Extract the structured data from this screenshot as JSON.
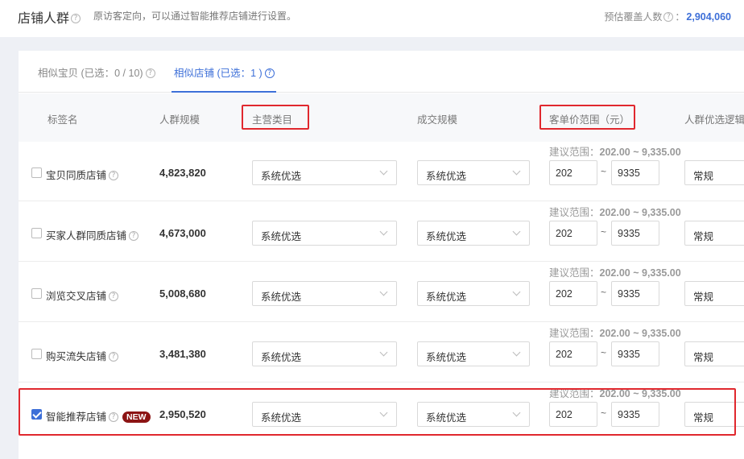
{
  "header": {
    "title": "店铺人群",
    "description": "原访客定向，可以通过智能推荐店铺进行设置。",
    "estimate_label": "预估覆盖人数",
    "estimate_suffix": "：",
    "estimate_value": "2,904,060"
  },
  "tabs": [
    {
      "label": "相似宝贝 (已选：0 / 10)",
      "active": false
    },
    {
      "label": "相似店铺 (已选：1 )",
      "active": true
    }
  ],
  "columns": {
    "tag_name": "标签名",
    "audience_size": "人群规模",
    "main_category": "主营类目",
    "deal_scale": "成交规模",
    "price_range": "客单价范围（元）",
    "logic": "人群优选逻辑"
  },
  "rows": [
    {
      "name": "宝贝同质店铺",
      "scale": "4,823,820",
      "category": "系统优选",
      "deal": "系统优选",
      "hint_label": "建议范围：",
      "hint_value": "202.00 ~ 9,335.00",
      "min": "202",
      "tilde": "~",
      "max": "9335",
      "logic": "常规",
      "checked": false,
      "badge": ""
    },
    {
      "name": "买家人群同质店铺",
      "scale": "4,673,000",
      "category": "系统优选",
      "deal": "系统优选",
      "hint_label": "建议范围：",
      "hint_value": "202.00 ~ 9,335.00",
      "min": "202",
      "tilde": "~",
      "max": "9335",
      "logic": "常规",
      "checked": false,
      "badge": ""
    },
    {
      "name": "浏览交叉店铺",
      "scale": "5,008,680",
      "category": "系统优选",
      "deal": "系统优选",
      "hint_label": "建议范围：",
      "hint_value": "202.00 ~ 9,335.00",
      "min": "202",
      "tilde": "~",
      "max": "9335",
      "logic": "常规",
      "checked": false,
      "badge": ""
    },
    {
      "name": "购买流失店铺",
      "scale": "3,481,380",
      "category": "系统优选",
      "deal": "系统优选",
      "hint_label": "建议范围：",
      "hint_value": "202.00 ~ 9,335.00",
      "min": "202",
      "tilde": "~",
      "max": "9335",
      "logic": "常规",
      "checked": false,
      "badge": ""
    },
    {
      "name": "智能推荐店铺",
      "scale": "2,950,520",
      "category": "系统优选",
      "deal": "系统优选",
      "hint_label": "建议范围：",
      "hint_value": "202.00 ~ 9,335.00",
      "min": "202",
      "tilde": "~",
      "max": "9335",
      "logic": "常规",
      "checked": true,
      "badge": "NEW"
    }
  ],
  "icons": {
    "help": "question-circle-icon",
    "dropdown": "chevron-down-icon",
    "check": "check-icon"
  },
  "colors": {
    "accent": "#3d6fd8",
    "highlight": "#e0282e",
    "badge": "#8c1414"
  }
}
